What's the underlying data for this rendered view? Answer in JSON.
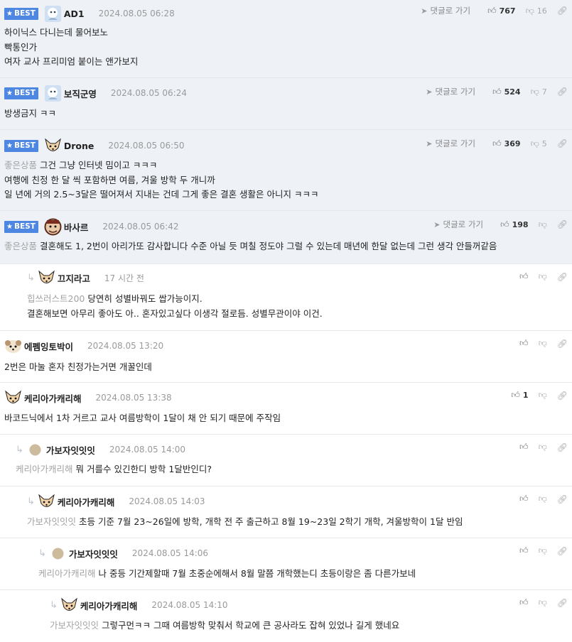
{
  "best_label": "BEST",
  "goto_label": "댓글로 가기",
  "comments": [
    {
      "nick": "AD1",
      "date": "2024.08.05 06:28",
      "up": "767",
      "down": "16",
      "lines": [
        "하이닉스 다니는데 물어보노",
        "빡통인가",
        "여자 교사 프리미엄 붙이는 앤가보지"
      ]
    },
    {
      "nick": "보직군영",
      "date": "2024.08.05 06:24",
      "up": "524",
      "down": "7",
      "lines": [
        "방생금지 ㅋㅋ"
      ]
    },
    {
      "nick": "Drone",
      "date": "2024.08.05 06:50",
      "up": "369",
      "down": "5",
      "tag": "좋은상품",
      "lines": [
        "그건 그냥 인터넷 밈이고 ㅋㅋㅋ",
        "여행에 친정 한 달 씩 포함하면 여름, 겨울 방학 두 개니까",
        "일 년에 거의 2.5~3달은 떨어져서 지내는 건데 그게 좋은 결혼 생활은 아니지 ㅋㅋㅋ"
      ]
    },
    {
      "nick": "바사르",
      "date": "2024.08.05 06:42",
      "up": "198",
      "tag": "좋은상품",
      "lines": [
        "결혼해도 1, 2번이 아리가또 감사합니다 수준 아닐 듯 며칠 정도야 그럴 수 있는데 매년에 한달 없는데 그런 생각 안들꺼같음"
      ]
    },
    {
      "nick": "끄지라고",
      "date": "17 시간 전",
      "tag": "힙쓰러스트200",
      "lines": [
        "당연히 성별바꿔도 쌉가능이지.",
        "결혼해보면 아무리 좋아도 아.. 혼자있고싶다 이생각 절로듬. 성별무관이야 이건."
      ]
    },
    {
      "nick": "에펨잉토박이",
      "date": "2024.08.05 13:20",
      "lines": [
        "2번은 마눌 혼자 친정가는거면 개꿀인데"
      ]
    },
    {
      "nick": "케리아가캐리해",
      "date": "2024.08.05 13:38",
      "up": "1",
      "lines": [
        "바코드닉에서 1차 거르고 교사 여름방학이 1달이 채 안 되기 때문에 주작임"
      ]
    },
    {
      "nick": "가보자잇잇잇",
      "date": "2024.08.05 14:00",
      "tag": "케리아가캐리해",
      "lines": [
        "뭐 거를수 있긴한디 방학 1달반인디?"
      ]
    },
    {
      "nick": "케리아가캐리해",
      "date": "2024.08.05 14:03",
      "tag": "가보자잇잇잇",
      "lines": [
        "초등 기준 7월 23~26일에 방학, 개학 전 주 출근하고 8월 19~23일 2학기 개학, 겨울방학이 1달 반임"
      ]
    },
    {
      "nick": "가보자잇잇잇",
      "date": "2024.08.05 14:06",
      "tag": "케리아가캐리해",
      "lines": [
        "나 중등 기간제할때 7월 초중순에해서 8월 말쯤 개학했는디 초등이랑은 좀 다른가보네"
      ]
    },
    {
      "nick": "케리아가캐리해",
      "date": "2024.08.05 14:10",
      "tag": "가보자잇잇잇",
      "lines": [
        "그렇구먼ㅋㅋ 그때 여름방학 맞춰서 학교에 큰 공사라도 잡혀 있었나 길게 했네요"
      ]
    }
  ],
  "icons": {
    "like": "thumbs-up-icon",
    "dislike": "thumbs-down-icon",
    "link": "link-icon",
    "goto": "paper-plane-icon",
    "reply": "reply-arrow-icon",
    "star": "star-icon"
  }
}
